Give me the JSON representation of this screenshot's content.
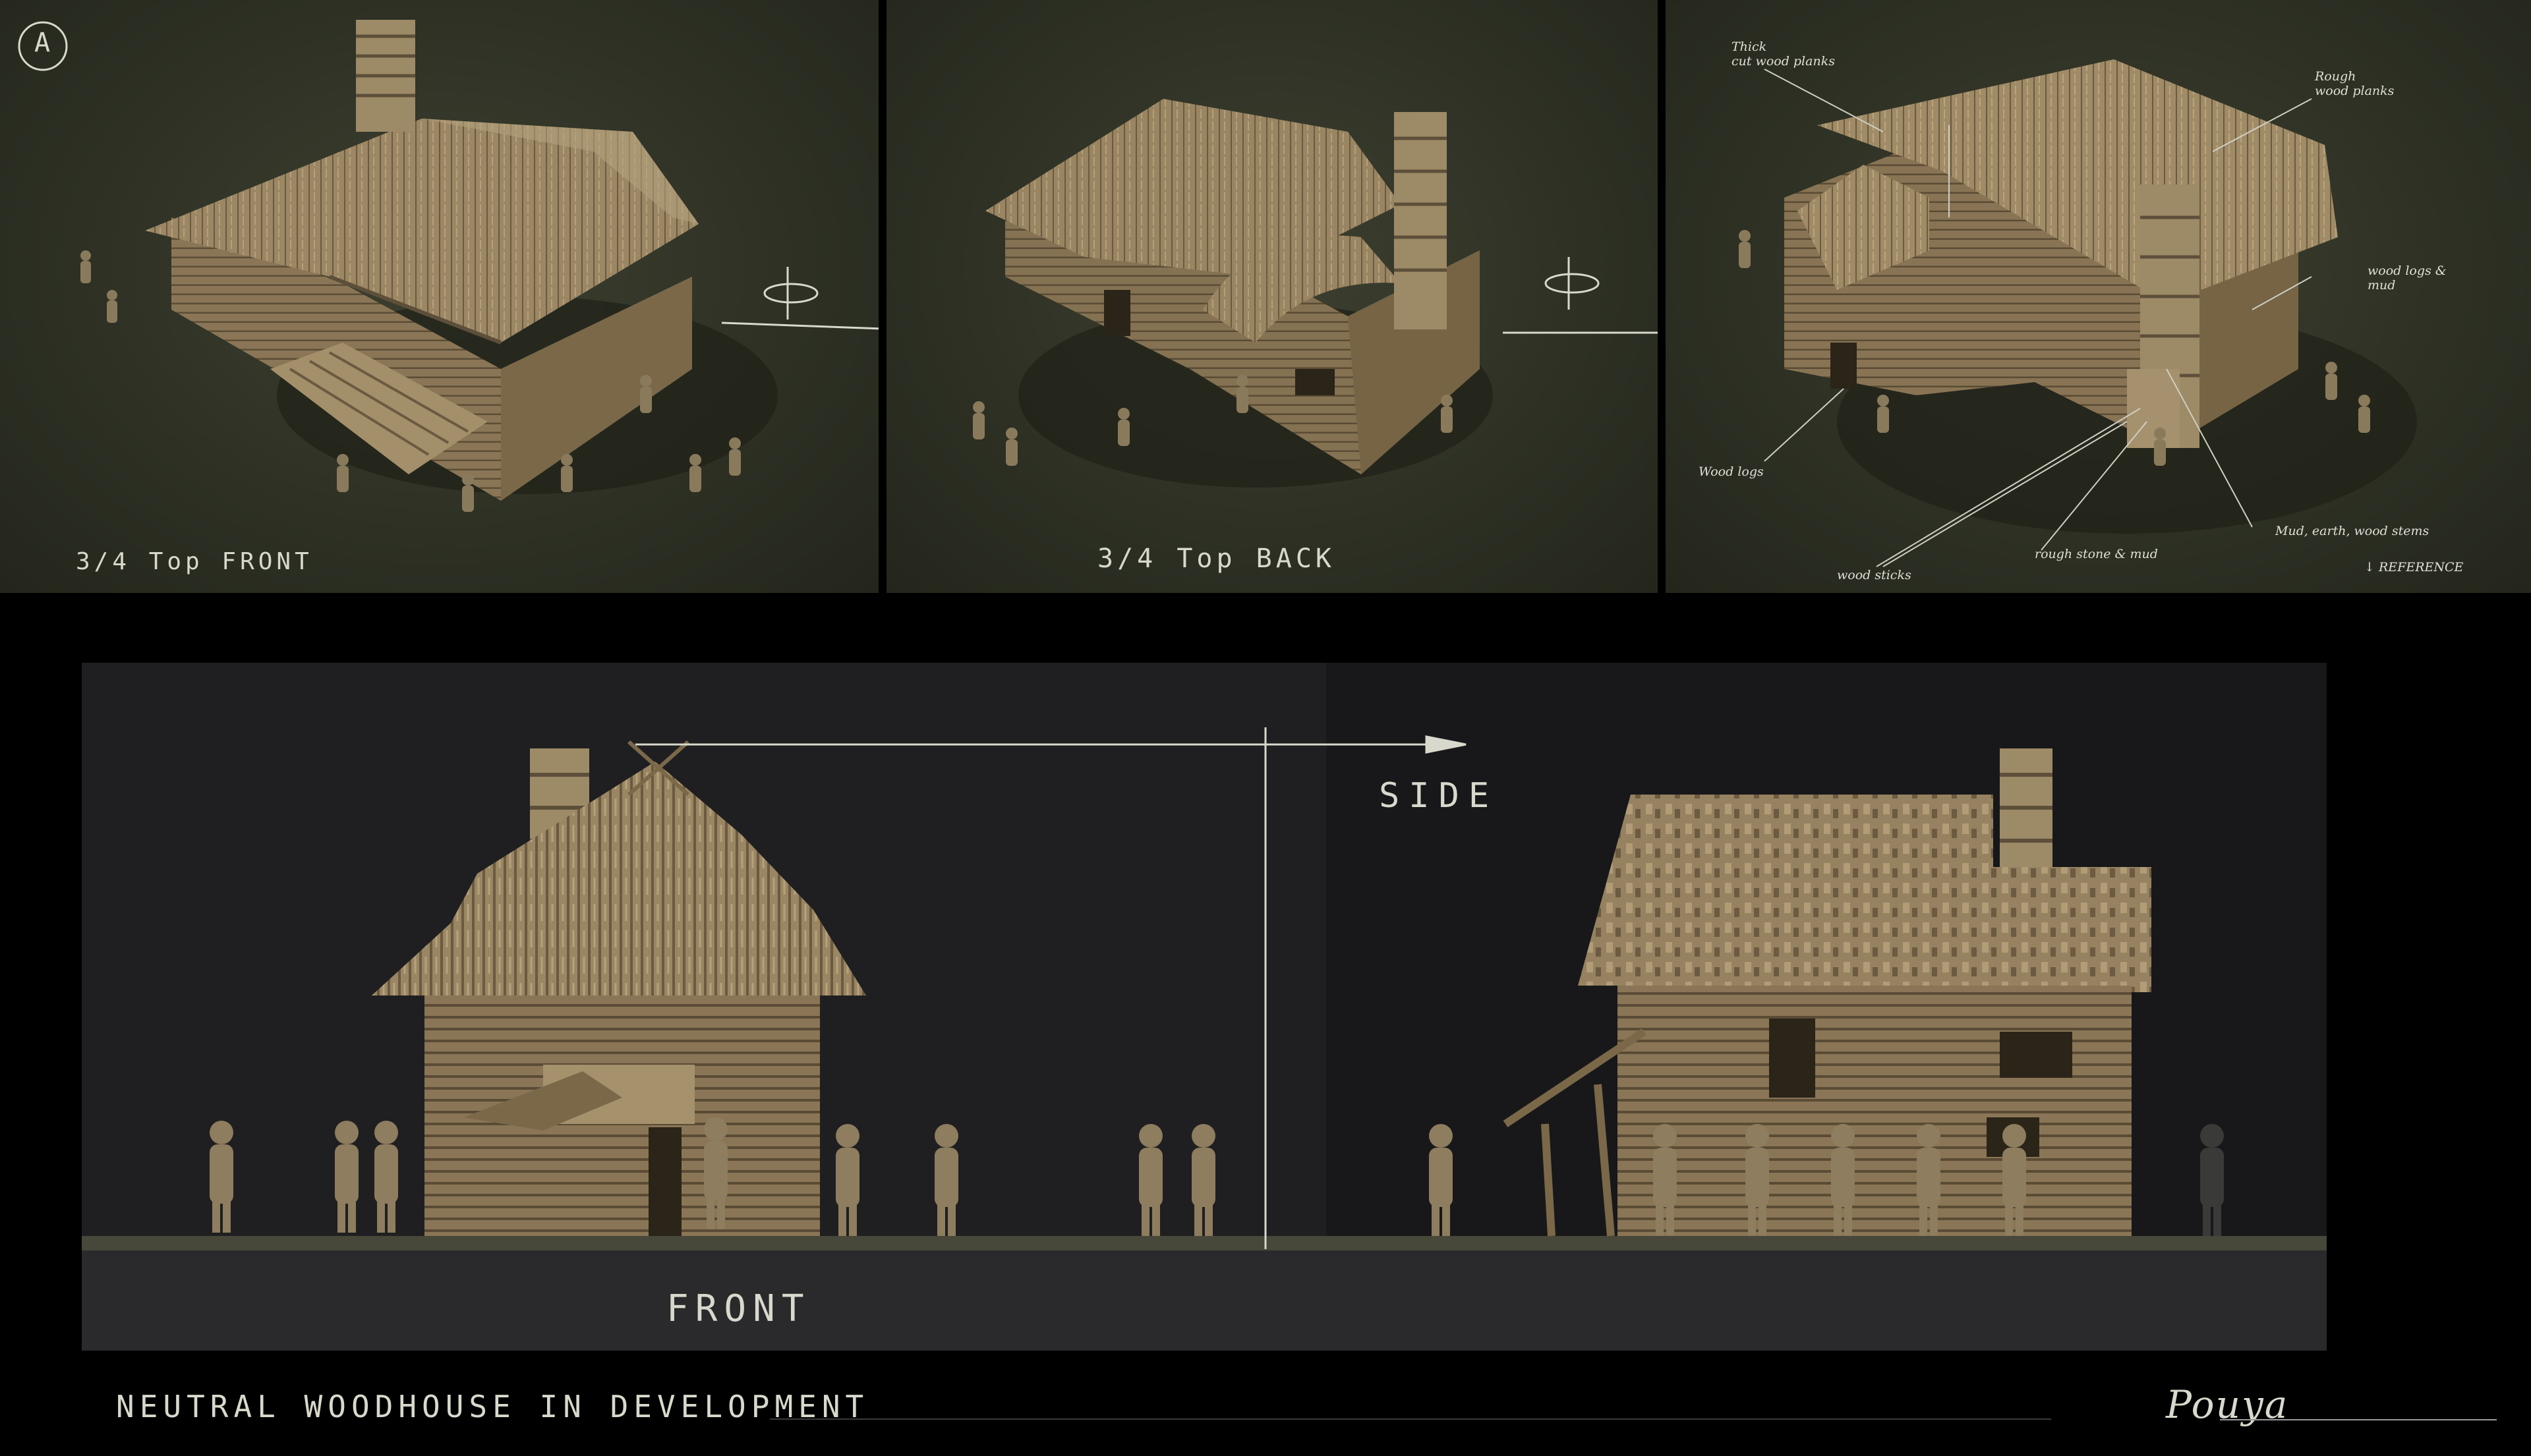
{
  "panels": {
    "top_front": {
      "marker": "A",
      "caption": "3/4 Top FRONT"
    },
    "top_back": {
      "caption": "3/4 Top BACK"
    },
    "reference": {
      "notes": {
        "thick_planks": "Thick\ncut wood planks",
        "rough_planks": "Rough\nwood planks",
        "logs_mud": "wood logs &\nmud",
        "wood_logs": "Wood logs",
        "wood_sticks": "wood sticks",
        "rough_stone": "rough stone & mud",
        "mud_earth": "Mud, earth, wood stems",
        "reference": "↓ REFERENCE"
      }
    }
  },
  "elevations": {
    "side_label": "SIDE",
    "front_label": "FRONT"
  },
  "footer": {
    "title": "NEUTRAL WOODHOUSE IN DEVELOPMENT",
    "signature": "Pouya"
  },
  "colors": {
    "clay": "#8f7c5e",
    "clay_light": "#a8946f",
    "clay_dark": "#5d4f3a",
    "panel_bg": "#2e3124"
  }
}
